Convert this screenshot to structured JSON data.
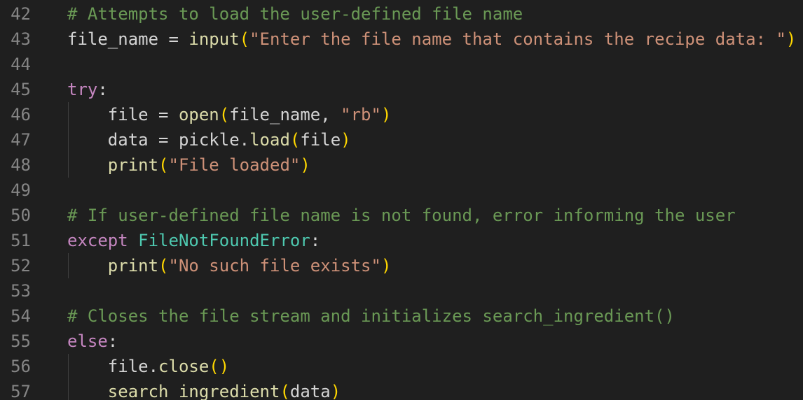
{
  "editor": {
    "language": "python",
    "colors": {
      "background": "#1f1f1f",
      "line_number": "#858585",
      "comment": "#6a9955",
      "keyword": "#c586c0",
      "function": "#dcdcaa",
      "string": "#ce9178",
      "class": "#4ec9b0",
      "bracket": "#ffd700",
      "text": "#d4d4d4"
    },
    "lines": [
      {
        "num": "42",
        "tokens": [
          {
            "t": "# Attempts to load the user-defined file name",
            "c": "c"
          }
        ]
      },
      {
        "num": "43",
        "tokens": [
          {
            "t": "file_name = ",
            "c": "tx"
          },
          {
            "t": "input",
            "c": "fn"
          },
          {
            "t": "(",
            "c": "p1"
          },
          {
            "t": "\"Enter the file name that contains the recipe data: \"",
            "c": "st"
          },
          {
            "t": ")",
            "c": "p1"
          }
        ]
      },
      {
        "num": "44",
        "tokens": []
      },
      {
        "num": "45",
        "tokens": [
          {
            "t": "try",
            "c": "kw"
          },
          {
            "t": ":",
            "c": "tx"
          }
        ]
      },
      {
        "num": "46",
        "tokens": [
          {
            "t": "    file = ",
            "c": "tx"
          },
          {
            "t": "open",
            "c": "fn"
          },
          {
            "t": "(",
            "c": "p1"
          },
          {
            "t": "file_name, ",
            "c": "tx"
          },
          {
            "t": "\"rb\"",
            "c": "st"
          },
          {
            "t": ")",
            "c": "p1"
          }
        ]
      },
      {
        "num": "47",
        "tokens": [
          {
            "t": "    data = pickle.",
            "c": "tx"
          },
          {
            "t": "load",
            "c": "fn"
          },
          {
            "t": "(",
            "c": "p1"
          },
          {
            "t": "file",
            "c": "tx"
          },
          {
            "t": ")",
            "c": "p1"
          }
        ]
      },
      {
        "num": "48",
        "tokens": [
          {
            "t": "    ",
            "c": "tx"
          },
          {
            "t": "print",
            "c": "fn"
          },
          {
            "t": "(",
            "c": "p1"
          },
          {
            "t": "\"File loaded\"",
            "c": "st"
          },
          {
            "t": ")",
            "c": "p1"
          }
        ]
      },
      {
        "num": "49",
        "tokens": []
      },
      {
        "num": "50",
        "tokens": [
          {
            "t": "# If user-defined file name is not found, error informing the user",
            "c": "c"
          }
        ]
      },
      {
        "num": "51",
        "tokens": [
          {
            "t": "except ",
            "c": "kw"
          },
          {
            "t": "FileNotFoundError",
            "c": "cl"
          },
          {
            "t": ":",
            "c": "tx"
          }
        ]
      },
      {
        "num": "52",
        "tokens": [
          {
            "t": "    ",
            "c": "tx"
          },
          {
            "t": "print",
            "c": "fn"
          },
          {
            "t": "(",
            "c": "p1"
          },
          {
            "t": "\"No such file exists\"",
            "c": "st"
          },
          {
            "t": ")",
            "c": "p1"
          }
        ]
      },
      {
        "num": "53",
        "tokens": []
      },
      {
        "num": "54",
        "tokens": [
          {
            "t": "# Closes the file stream and initializes search_ingredient()",
            "c": "c"
          }
        ]
      },
      {
        "num": "55",
        "tokens": [
          {
            "t": "else",
            "c": "kw"
          },
          {
            "t": ":",
            "c": "tx"
          }
        ]
      },
      {
        "num": "56",
        "tokens": [
          {
            "t": "    file.",
            "c": "tx"
          },
          {
            "t": "close",
            "c": "fn"
          },
          {
            "t": "()",
            "c": "p1"
          }
        ]
      },
      {
        "num": "57",
        "tokens": [
          {
            "t": "    ",
            "c": "tx"
          },
          {
            "t": "search_ingredient",
            "c": "fn"
          },
          {
            "t": "(",
            "c": "p1"
          },
          {
            "t": "data",
            "c": "tx"
          },
          {
            "t": ")",
            "c": "p1"
          }
        ]
      }
    ]
  }
}
